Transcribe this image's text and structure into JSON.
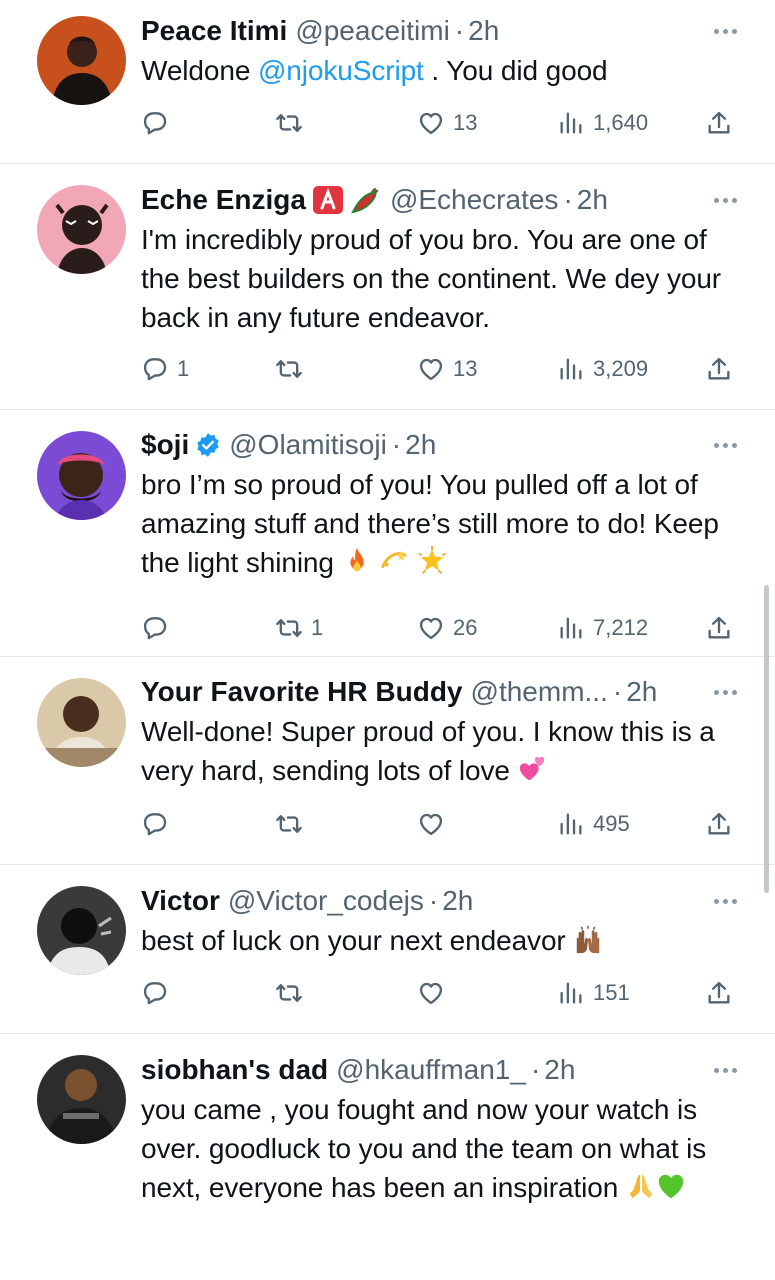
{
  "tweets": [
    {
      "name": "Peace Itimi",
      "handle": "@peaceitimi",
      "time": "2h",
      "text_before": "Weldone ",
      "mention": "@njokuScript",
      "text_after": " . You did good",
      "replies": "",
      "retweets": "",
      "likes": "13",
      "views": "1,640"
    },
    {
      "name": "Eche Enziga",
      "badges": [
        "A-button-icon",
        "hot-pepper-icon"
      ],
      "handle": "@Echecrates",
      "time": "2h",
      "text": "I'm incredibly proud of you bro. You are one of the best builders on the continent. We dey your back in any future endeavor.",
      "replies": "1",
      "retweets": "",
      "likes": "13",
      "views": "3,209"
    },
    {
      "name": "$oji",
      "badges": [
        "verified-icon"
      ],
      "handle": "@Olamitisoji",
      "time": "2h",
      "text": "bro I’m so proud of you! You pulled off a lot of amazing stuff and there’s still more to do! Keep the light shining",
      "emojis": [
        "fire-emoji",
        "dizzy-emoji",
        "glowing-star-emoji"
      ],
      "replies": "",
      "retweets": "1",
      "likes": "26",
      "views": "7,212"
    },
    {
      "name": "Your Favorite HR Buddy",
      "handle": "@themm...",
      "time": "2h",
      "text": "Well-done! Super proud of you. I know this is a very hard, sending lots of love",
      "emojis": [
        "two-hearts-emoji"
      ],
      "replies": "",
      "retweets": "",
      "likes": "",
      "views": "495"
    },
    {
      "name": "Victor",
      "handle": "@Victor_codejs",
      "time": "2h",
      "text": "best of luck on your next endeavor",
      "emojis": [
        "raising-hands-emoji"
      ],
      "replies": "",
      "retweets": "",
      "likes": "",
      "views": "151"
    },
    {
      "name": "siobhan's dad",
      "handle": "@hkauffman1_",
      "time": "2h",
      "text": "you came , you fought and now your watch is over. goodluck to you and the team on what is next, everyone has been an inspiration",
      "emojis": [
        "folded-hands-emoji",
        "green-heart-emoji"
      ]
    }
  ],
  "dot_separator": "·",
  "colors": {
    "text": "#0f1419",
    "muted": "#536471",
    "link": "#1d9bf0",
    "divider": "#e3e7ea"
  }
}
